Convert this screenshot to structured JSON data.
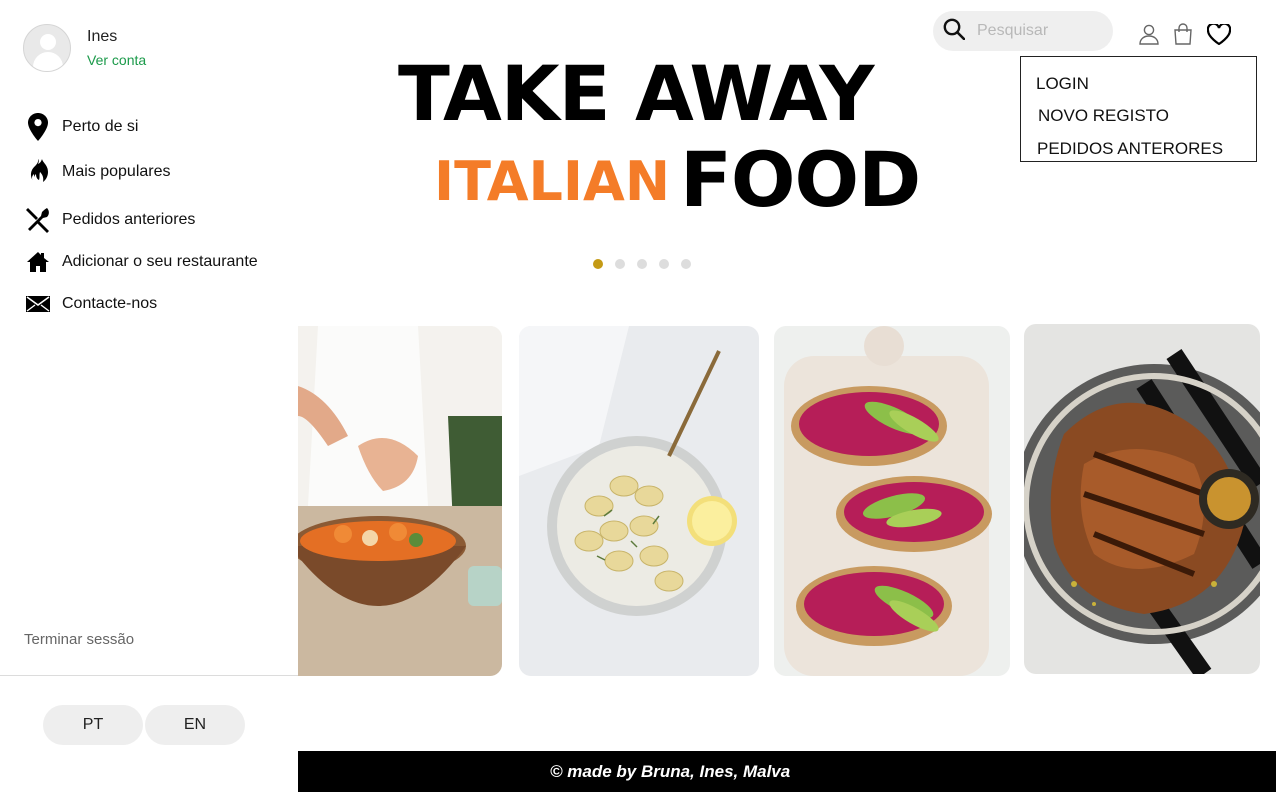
{
  "profile": {
    "name": "Ines",
    "link": "Ver conta"
  },
  "sidebar": {
    "items": [
      {
        "label": "Perto de si",
        "icon": "map-pin-icon"
      },
      {
        "label": "Mais populares",
        "icon": "fire-icon"
      },
      {
        "label": "Pedidos anteriores",
        "icon": "utensils-icon"
      },
      {
        "label": "Adicionar o seu restaurante",
        "icon": "home-icon"
      },
      {
        "label": "Contacte-nos",
        "icon": "envelope-icon"
      }
    ],
    "logout": "Terminar sessão",
    "languages": [
      "PT",
      "EN"
    ]
  },
  "header": {
    "search_placeholder": "Pesquisar",
    "icons": [
      "user-icon",
      "shopping-bag-icon",
      "heart-icon"
    ]
  },
  "dropdown": {
    "items": [
      "LOGIN",
      "NOVO REGISTO",
      "PEDIDOS ANTERORES"
    ]
  },
  "hero": {
    "line1": "TAKE AWAY",
    "accent": "ITALIAN",
    "line2": "FOOD",
    "accent_color": "#f47c28",
    "slide_count": 5,
    "active_slide": 1
  },
  "cards": [
    {
      "name": "salad-preparation-image"
    },
    {
      "name": "tortellini-plate-image"
    },
    {
      "name": "beet-avocado-toast-image"
    },
    {
      "name": "grilled-chicken-image"
    }
  ],
  "footer": {
    "text": "©  made by Bruna, Ines, Malva"
  },
  "colors": {
    "link": "#1b9a4a",
    "dot_active": "#c49a15",
    "footer_bg": "#000000"
  }
}
